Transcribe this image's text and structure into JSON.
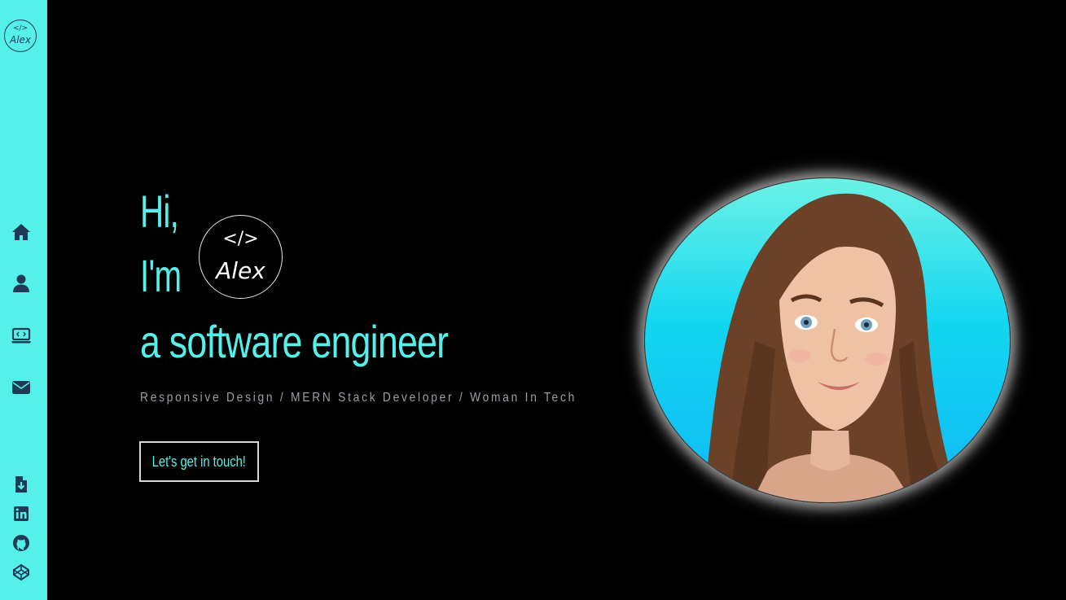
{
  "brand": {
    "code_glyph": "</>",
    "name": "Alex"
  },
  "sidebar": {
    "nav": [
      {
        "icon": "home-icon",
        "label": "Home"
      },
      {
        "icon": "user-icon",
        "label": "About"
      },
      {
        "icon": "laptop-code-icon",
        "label": "Projects"
      },
      {
        "icon": "envelope-icon",
        "label": "Contact"
      }
    ],
    "social": [
      {
        "icon": "file-download-icon",
        "label": "Resume"
      },
      {
        "icon": "linkedin-icon",
        "label": "LinkedIn"
      },
      {
        "icon": "github-icon",
        "label": "GitHub"
      },
      {
        "icon": "codepen-icon",
        "label": "CodePen"
      }
    ],
    "colors": {
      "background": "#55f0ea",
      "icon": "#1f3a55"
    }
  },
  "hero": {
    "greeting": "Hi,",
    "intro": "I'm",
    "role": "a software engineer",
    "tagline": "Responsive Design / MERN Stack Developer / Woman In Tech",
    "cta_label": "Let's get in touch!",
    "avatar_alt": "avatar",
    "colors": {
      "accent": "#55f0ea",
      "tagline": "#9aa0a6",
      "page_background": "#000000"
    }
  }
}
